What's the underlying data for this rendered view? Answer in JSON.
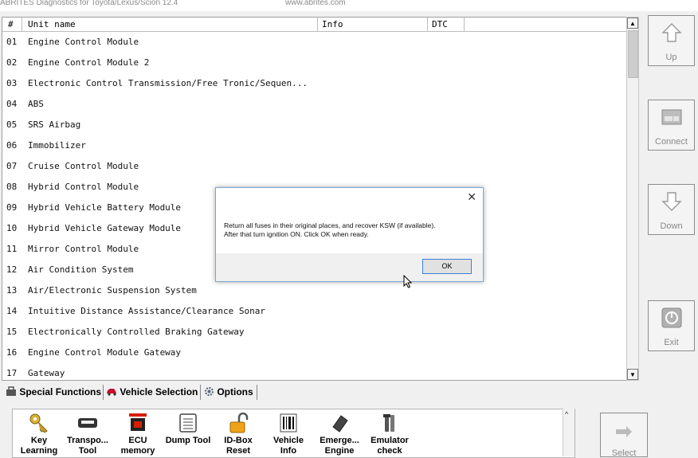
{
  "window": {
    "title": "ABRITES Diagnostics for Toyota/Lexus/Scion 12.4",
    "url": "www.abrites.com"
  },
  "list": {
    "columns": [
      "#",
      "Unit name",
      "Info",
      "DTC"
    ],
    "rows": [
      {
        "num": "01",
        "name": "Engine Control Module"
      },
      {
        "num": "02",
        "name": "Engine Control Module 2"
      },
      {
        "num": "03",
        "name": "Electronic Control Transmission/Free Tronic/Sequen..."
      },
      {
        "num": "04",
        "name": "ABS"
      },
      {
        "num": "05",
        "name": "SRS Airbag"
      },
      {
        "num": "06",
        "name": "Immobilizer"
      },
      {
        "num": "07",
        "name": "Cruise Control Module"
      },
      {
        "num": "08",
        "name": "Hybrid Control Module"
      },
      {
        "num": "09",
        "name": "Hybrid Vehicle Battery Module"
      },
      {
        "num": "10",
        "name": "Hybrid Vehicle Gateway Module"
      },
      {
        "num": "11",
        "name": "Mirror Control Module"
      },
      {
        "num": "12",
        "name": "Air Condition System"
      },
      {
        "num": "13",
        "name": "Air/Electronic Suspension System"
      },
      {
        "num": "14",
        "name": "Intuitive Distance Assistance/Clearance Sonar"
      },
      {
        "num": "15",
        "name": "Electronically Controlled Braking Gateway"
      },
      {
        "num": "16",
        "name": "Engine Control Module Gateway"
      },
      {
        "num": "17",
        "name": "Gateway"
      }
    ]
  },
  "side_buttons": {
    "up": "Up",
    "connect": "Connect",
    "down": "Down",
    "exit": "Exit",
    "select": "Select"
  },
  "dialog": {
    "message_line1": "Return all fuses in their original places, and recover KSW (if available).",
    "message_line2": "After that turn ignition ON. Click OK when ready.",
    "ok_label": "OK",
    "close_glyph": "✕"
  },
  "tabs": [
    {
      "label": "Special Functions"
    },
    {
      "label": "Vehicle Selection"
    },
    {
      "label": "Options"
    }
  ],
  "tools": [
    {
      "line1": "Key",
      "line2": "Learning"
    },
    {
      "line1": "Transpo...",
      "line2": "Tool"
    },
    {
      "line1": "ECU",
      "line2": "memory"
    },
    {
      "line1": "Dump Tool",
      "line2": ""
    },
    {
      "line1": "ID-Box",
      "line2": "Reset"
    },
    {
      "line1": "Vehicle",
      "line2": "Info"
    },
    {
      "line1": "Emerge...",
      "line2": "Engine"
    },
    {
      "line1": "Emulator",
      "line2": "check"
    }
  ],
  "colors": {
    "dialog_border": "#7aa7d6",
    "ok_border": "#3c7fd4",
    "ecu_icon_red": "#d81e05"
  }
}
